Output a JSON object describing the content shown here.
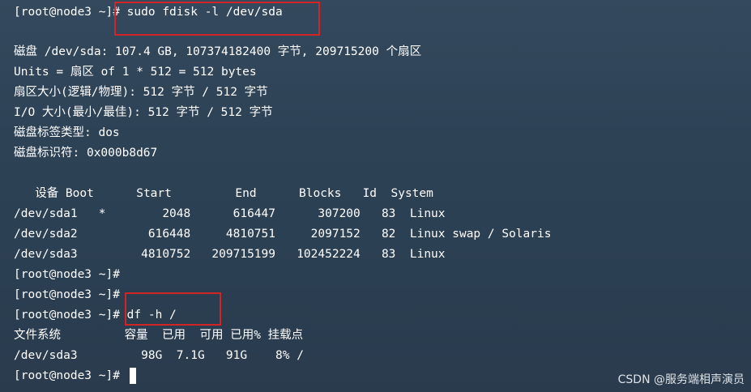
{
  "terminal": {
    "lines": [
      "[root@node3 ~]# sudo fdisk -l /dev/sda",
      "",
      "磁盘 /dev/sda: 107.4 GB, 107374182400 字节, 209715200 个扇区",
      "Units = 扇区 of 1 * 512 = 512 bytes",
      "扇区大小(逻辑/物理): 512 字节 / 512 字节",
      "I/O 大小(最小/最佳): 512 字节 / 512 字节",
      "磁盘标签类型: dos",
      "磁盘标识符: 0x000b8d67",
      "",
      "   设备 Boot      Start         End      Blocks   Id  System",
      "/dev/sda1   *        2048      616447      307200   83  Linux",
      "/dev/sda2          616448     4810751     2097152   82  Linux swap / Solaris",
      "/dev/sda3         4810752   209715199   102452224   83  Linux",
      "[root@node3 ~]#",
      "[root@node3 ~]#",
      "[root@node3 ~]# df -h /",
      "文件系统         容量  已用  可用 已用% 挂载点",
      "/dev/sda3         98G  7.1G   91G    8% /",
      "[root@node3 ~]# "
    ]
  },
  "colors": {
    "highlight_box": "#d22424",
    "text": "#ffffff",
    "background": "#2e4256"
  },
  "watermark": "CSDN @服务端相声演员"
}
